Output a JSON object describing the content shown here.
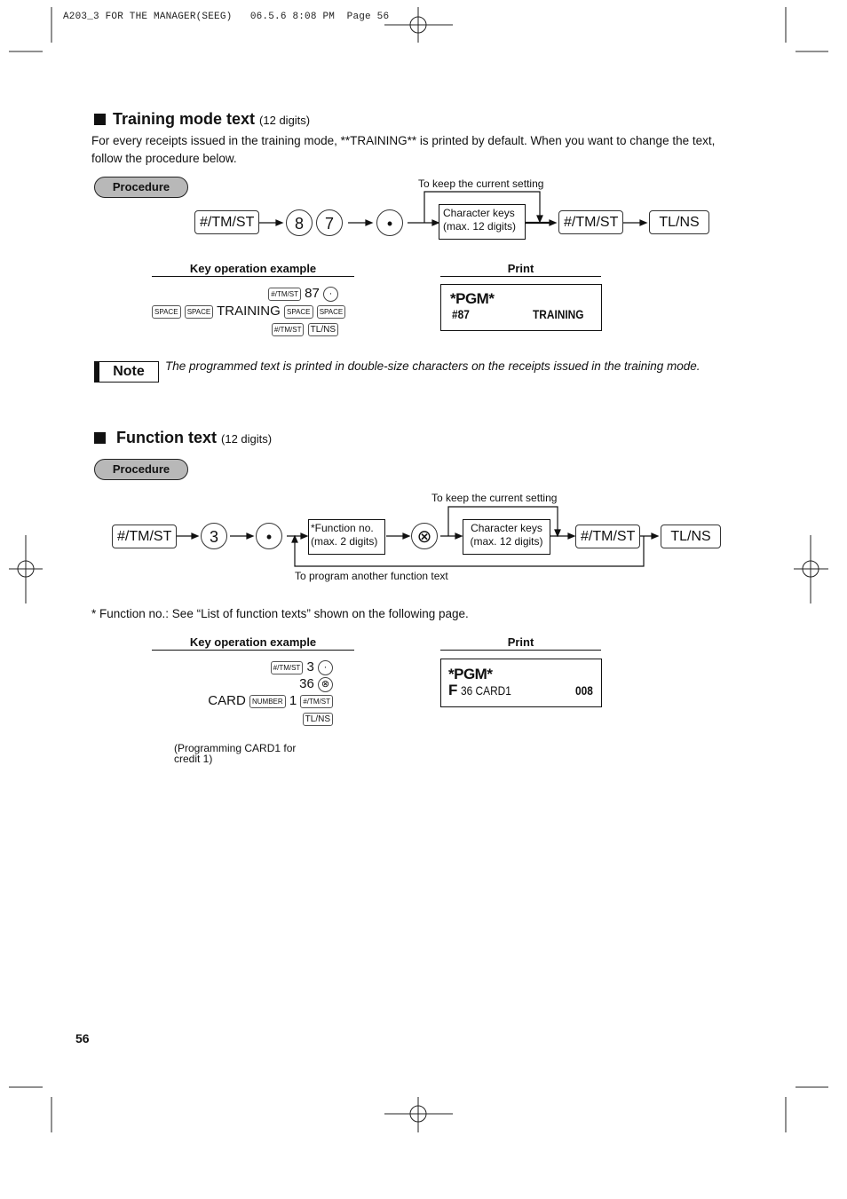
{
  "print_header": "A203_3 FOR THE MANAGER(SEEG)   06.5.6 8:08 PM  Page 56",
  "sections": {
    "training": {
      "title": "Training mode text",
      "digits": "(12 digits)",
      "description": "For every receipts issued in the training mode, **TRAINING** is printed by default.  When you want to change the text, follow the procedure below.",
      "procedure_label": "Procedure",
      "flow": {
        "key_start": "#/TM/ST",
        "digit_1": "8",
        "digit_2": "7",
        "dot_key": "•",
        "bypass_label": "To keep the current setting",
        "char_box_line1": "Character keys",
        "char_box_line2": "(max. 12 digits)",
        "key_subtotal": "#/TM/ST",
        "key_total": "TL/NS"
      },
      "example": {
        "header": "Key operation example",
        "line1_key": "#/TM/ST",
        "line1_value": "87",
        "line1_circle": "·",
        "space_key": "SPACE",
        "line2_text": "TRAINING",
        "line3_key1": "#/TM/ST",
        "line3_key2": "TL/NS"
      },
      "print": {
        "header": "Print",
        "line1": "*PGM*",
        "line2_left": "#87",
        "line2_right": "TRAINING"
      },
      "note": {
        "badge": "Note",
        "text": "The programmed text is printed in double-size characters on the receipts issued in the training mode."
      }
    },
    "function": {
      "title": "Function text",
      "digits": "(12 digits)",
      "procedure_label": "Procedure",
      "flow": {
        "key_start": "#/TM/ST",
        "digit": "3",
        "dot_key": "•",
        "func_box_line1": "*Function no.",
        "func_box_line2": "(max. 2 digits)",
        "x_key": "⊗",
        "bypass_label": "To keep the current setting",
        "char_box_line1": "Character keys",
        "char_box_line2": "(max. 12 digits)",
        "key_subtotal": "#/TM/ST",
        "key_total": "TL/NS",
        "loop_label": "To program another function text"
      },
      "footnote": "* Function no.: See “List of function texts” shown on the following page.",
      "example": {
        "header": "Key operation example",
        "line1_key": "#/TM/ST",
        "line1_value": "3",
        "line1_circle": "·",
        "line2_value": "36",
        "line2_circle": "⊗",
        "line3_text": "CARD",
        "line3_key": "NUMBER",
        "line3_value": "1",
        "line3_key2": "#/TM/ST",
        "line4_key": "TL/NS",
        "caption": "(Programming CARD1 for credit 1)"
      },
      "print": {
        "header": "Print",
        "line1": "*PGM*",
        "line2_prefix": "F",
        "line2_left": "36 CARD1",
        "line2_right": "008"
      }
    }
  },
  "page_number": "56"
}
